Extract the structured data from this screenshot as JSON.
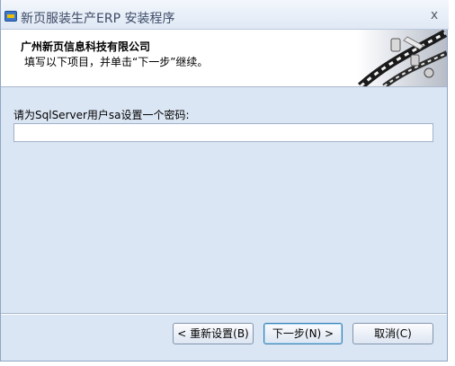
{
  "window": {
    "title": "新页服装生产ERP 安装程序",
    "close_label": "x"
  },
  "header": {
    "title": "广州新页信息科技有限公司",
    "subtitle": "填写以下项目，并单击“下一步”继续。"
  },
  "form": {
    "password_label": "请为SqlServer用户sa设置一个密码:",
    "password_value": ""
  },
  "buttons": {
    "back_label": "< 重新设置(B)",
    "next_label": "下一步(N) >",
    "cancel_label": "取消(C)"
  },
  "colors": {
    "window_bg": "#dbe6f4",
    "header_bg": "#ffffff",
    "title_text": "#3b4a66"
  }
}
